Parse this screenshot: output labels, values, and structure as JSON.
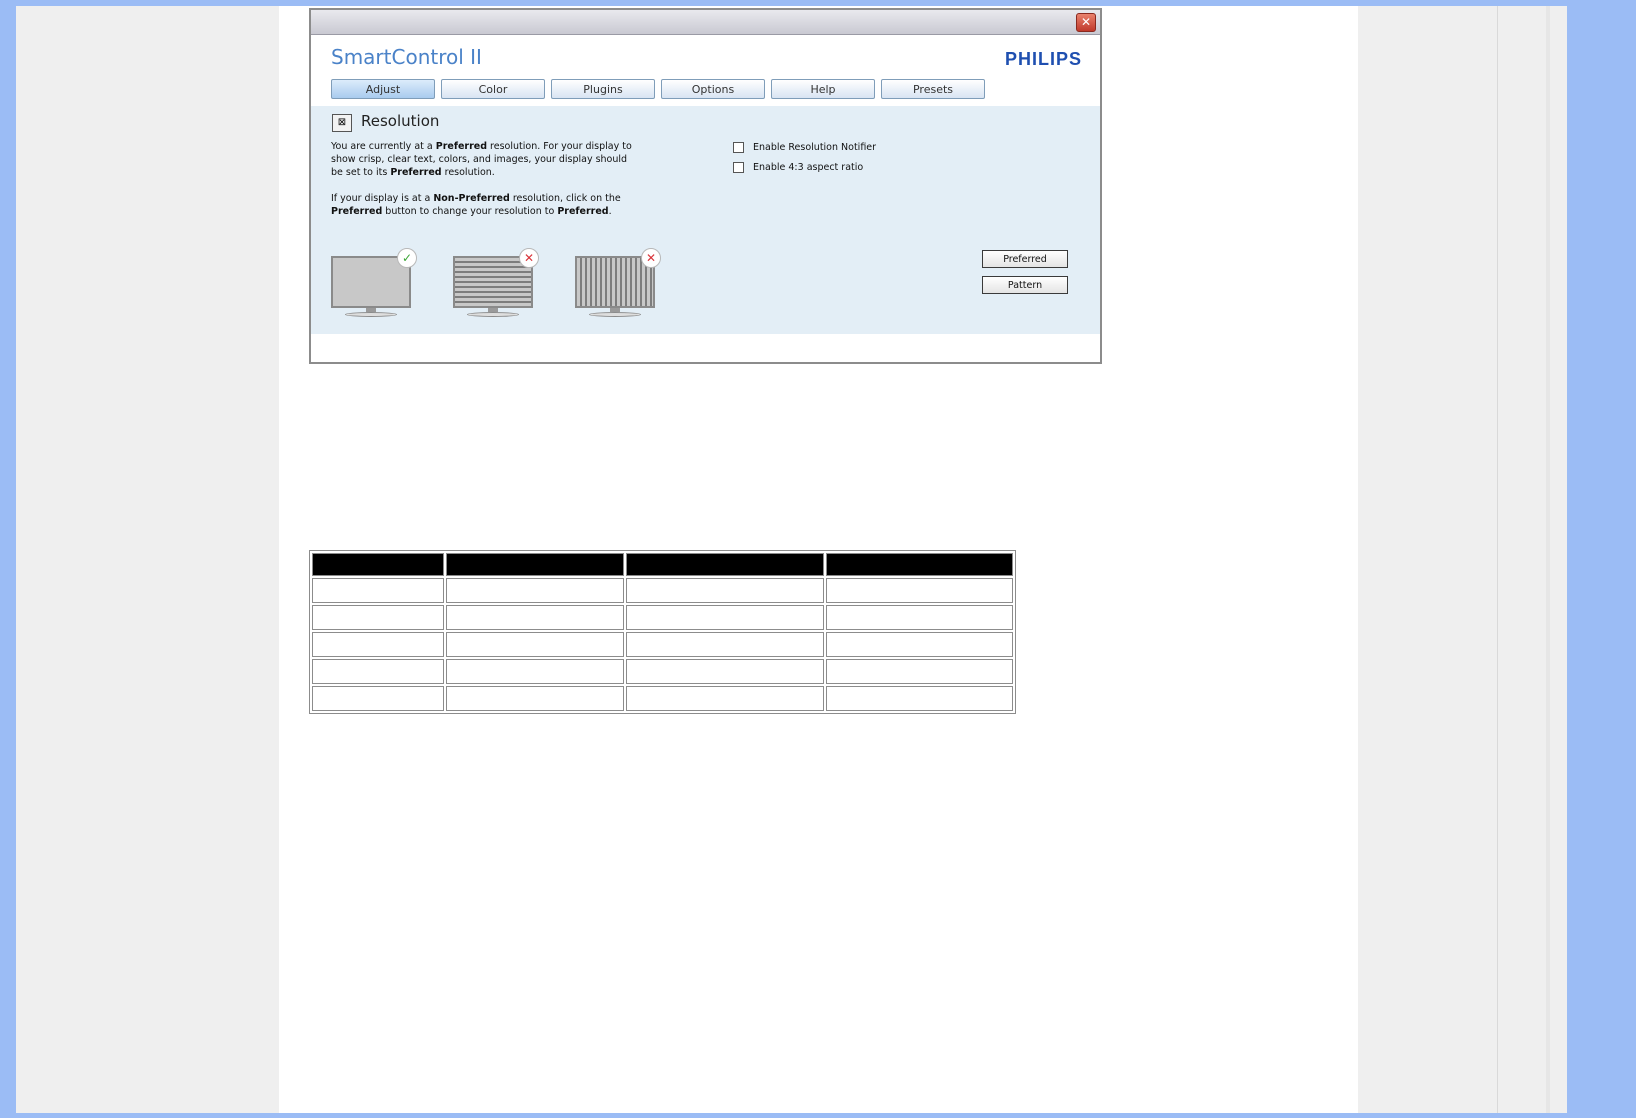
{
  "window": {
    "app_title": "SmartControl II",
    "brand": "PHILIPS",
    "close_glyph": "✕",
    "tabs": [
      {
        "label": "Adjust",
        "active": true
      },
      {
        "label": "Color"
      },
      {
        "label": "Plugins"
      },
      {
        "label": "Options"
      },
      {
        "label": "Help"
      },
      {
        "label": "Presets"
      }
    ],
    "section": {
      "icon": "resolution-icon",
      "title": "Resolution",
      "description_1_parts": [
        "You are currently at a ",
        "Preferred",
        " resolution. For your display to show crisp, clear text, colors, and images, your display should be set to its ",
        "Preferred",
        " resolution."
      ],
      "description_2_parts": [
        "If your display is at a ",
        "Non-Preferred",
        " resolution, click on the ",
        "Preferred",
        " button to change your resolution to ",
        "Preferred",
        "."
      ],
      "checkboxes": [
        {
          "label": "Enable Resolution Notifier",
          "checked": false
        },
        {
          "label": "Enable 4:3 aspect ratio",
          "checked": false
        }
      ],
      "monitors": [
        {
          "name": "preferred-monitor",
          "status": "check-icon",
          "glyph": "✓"
        },
        {
          "name": "horizontal-lines-monitor",
          "status": "x-icon",
          "glyph": "✕"
        },
        {
          "name": "vertical-lines-monitor",
          "status": "x-icon",
          "glyph": "✕"
        }
      ],
      "buttons": {
        "preferred": "Preferred",
        "pattern": "Pattern"
      }
    }
  },
  "table": {
    "header_color": "#000000",
    "columns": 4,
    "rows": 5
  }
}
